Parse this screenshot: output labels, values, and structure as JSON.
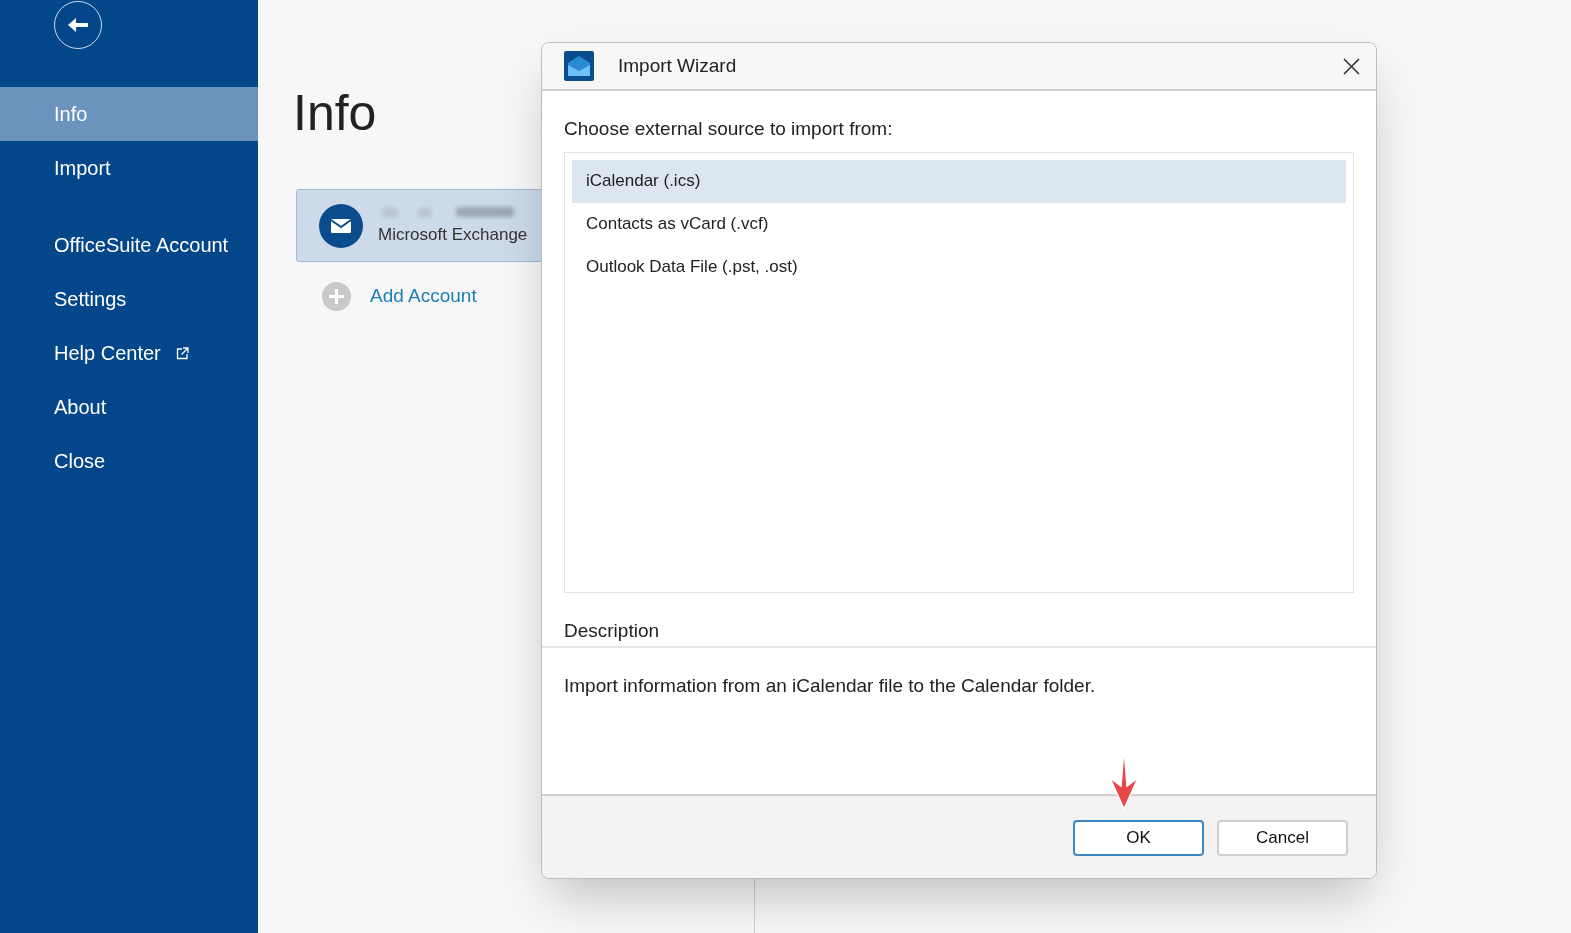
{
  "sidebar": {
    "sections": [
      {
        "items": [
          {
            "label": "Info",
            "selected": true,
            "external_link": false
          },
          {
            "label": "Import",
            "selected": false,
            "external_link": false
          }
        ]
      },
      {
        "items": [
          {
            "label": "OfficeSuite Account",
            "selected": false,
            "external_link": false
          },
          {
            "label": "Settings",
            "selected": false,
            "external_link": false
          },
          {
            "label": "Help Center",
            "selected": false,
            "external_link": true
          },
          {
            "label": "About",
            "selected": false,
            "external_link": false
          },
          {
            "label": "Close",
            "selected": false,
            "external_link": false
          }
        ]
      }
    ]
  },
  "page": {
    "title": "Info",
    "account": {
      "type": "Microsoft Exchange",
      "selected": true
    },
    "add_account": "Add Account"
  },
  "dialog": {
    "title": "Import Wizard",
    "prompt": "Choose external source to import from:",
    "sources": [
      {
        "label": "iCalendar (.ics)",
        "selected": true
      },
      {
        "label": "Contacts as vCard (.vcf)",
        "selected": false
      },
      {
        "label": "Outlook Data File (.pst, .ost)",
        "selected": false
      }
    ],
    "description_label": "Description",
    "description": "Import information from an iCalendar file to the Calendar folder.",
    "buttons": [
      {
        "label": "OK",
        "default": true
      },
      {
        "label": "Cancel",
        "default": false
      }
    ]
  }
}
